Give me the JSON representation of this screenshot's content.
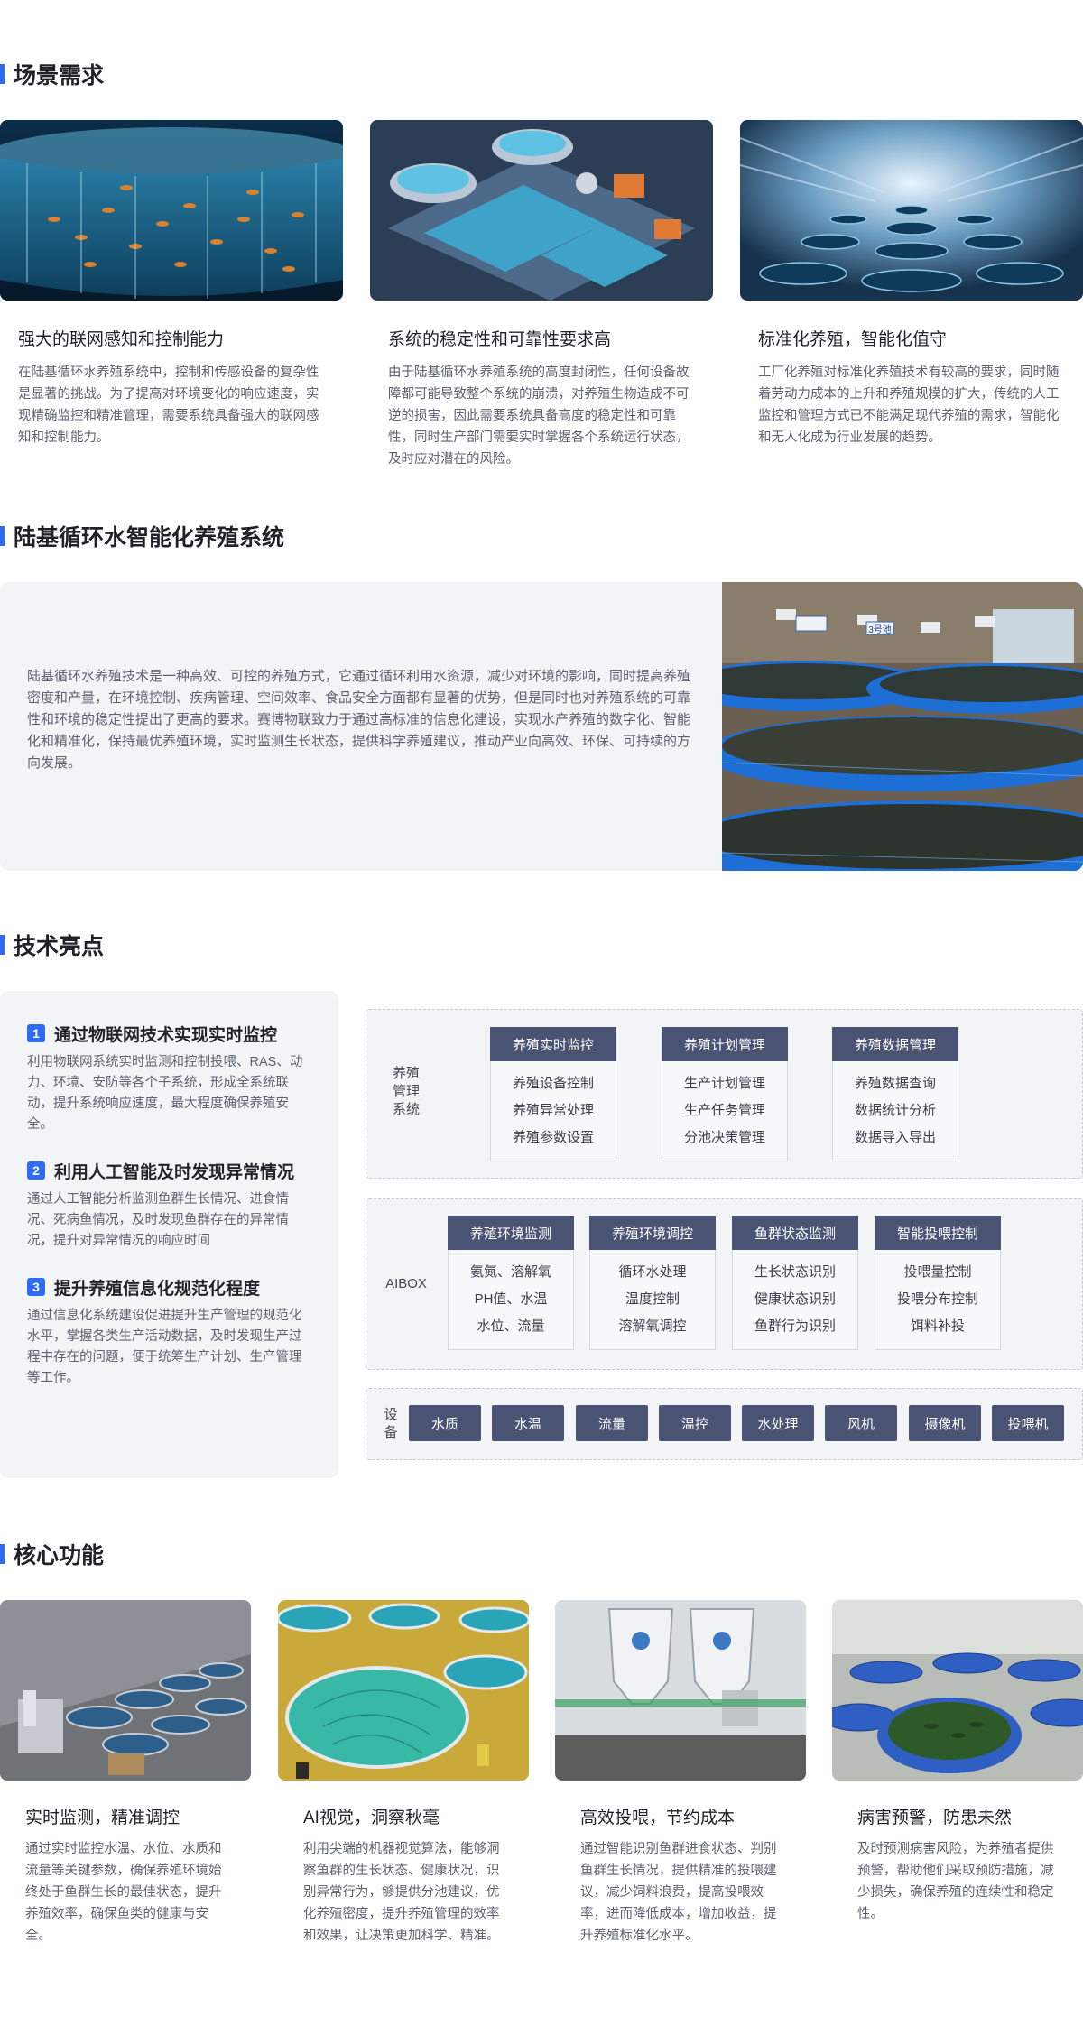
{
  "sections": {
    "scene": "场景需求",
    "system": "陆基循环水智能化养殖系统",
    "tech": "技术亮点",
    "core": "核心功能"
  },
  "scene_cards": [
    {
      "title": "强大的联网感知和控制能力",
      "text": "在陆基循环水养殖系统中，控制和传感设备的复杂性是显著的挑战。为了提高对环境变化的响应速度，实现精确监控和精准管理，需要系统具备强大的联网感知和控制能力。"
    },
    {
      "title": "系统的稳定性和可靠性要求高",
      "text": "由于陆基循环水养殖系统的高度封闭性，任何设备故障都可能导致整个系统的崩溃，对养殖生物造成不可逆的损害，因此需要系统具备高度的稳定性和可靠性，同时生产部门需要实时掌握各个系统运行状态，及时应对潜在的风险。"
    },
    {
      "title": "标准化养殖，智能化值守",
      "text": "工厂化养殖对标准化养殖技术有较高的要求，同时随着劳动力成本的上升和养殖规模的扩大，传统的人工监控和管理方式已不能满足现代养殖的需求，智能化和无人化成为行业发展的趋势。"
    }
  ],
  "intro": {
    "text": "陆基循环水养殖技术是一种高效、可控的养殖方式，它通过循环利用水资源，减少对环境的影响，同时提高养殖密度和产量，在环境控制、疾病管理、空间效率、食品安全方面都有显著的优势，但是同时也对养殖系统的可靠性和环境的稳定性提出了更高的要求。赛博物联致力于通过高标准的信息化建设，实现水产养殖的数字化、智能化和精准化，保持最优养殖环境，实时监测生长状态，提供科学养殖建议，推动产业向高效、环保、可持续的方向发展。",
    "tank_signs": [
      "3号池"
    ]
  },
  "highlights": [
    {
      "num": "1",
      "title": "通过物联网技术实现实时监控",
      "text": "利用物联网系统实时监测和控制投喂、RAS、动力、环境、安防等各个子系统，形成全系统联动，提升系统响应速度，最大程度确保养殖安全。"
    },
    {
      "num": "2",
      "title": "利用人工智能及时发现异常情况",
      "text": "通过人工智能分析监测鱼群生长情况、进食情况、死病鱼情况，及时发现鱼群存在的异常情况，提升对异常情况的响应时间"
    },
    {
      "num": "3",
      "title": "提升养殖信息化规范化程度",
      "text": "通过信息化系统建设促进提升生产管理的规范化水平，掌握各类生产活动数据，及时发现生产过程中存在的问题，便于统筹生产计划、生产管理等工作。"
    }
  ],
  "arch": {
    "mgmt_label": "养殖\n管理\n系统",
    "mgmt_modules": [
      {
        "title": "养殖实时监控",
        "items": [
          "养殖设备控制",
          "养殖异常处理",
          "养殖参数设置"
        ]
      },
      {
        "title": "养殖计划管理",
        "items": [
          "生产计划管理",
          "生产任务管理",
          "分池决策管理"
        ]
      },
      {
        "title": "养殖数据管理",
        "items": [
          "养殖数据查询",
          "数据统计分析",
          "数据导入导出"
        ]
      }
    ],
    "aibox_label": "AIBOX",
    "aibox_modules": [
      {
        "title": "养殖环境监测",
        "items": [
          "氨氮、溶解氧",
          "PH值、水温",
          "水位、流量"
        ]
      },
      {
        "title": "养殖环境调控",
        "items": [
          "循环水处理",
          "温度控制",
          "溶解氧调控"
        ]
      },
      {
        "title": "鱼群状态监测",
        "items": [
          "生长状态识别",
          "健康状态识别",
          "鱼群行为识别"
        ]
      },
      {
        "title": "智能投喂控制",
        "items": [
          "投喂量控制",
          "投喂分布控制",
          "饵料补投"
        ]
      }
    ],
    "device_label": "设\n备",
    "devices": [
      "水质",
      "水温",
      "流量",
      "温控",
      "水处理",
      "风机",
      "摄像机",
      "投喂机"
    ]
  },
  "core_cards": [
    {
      "title": "实时监测，精准调控",
      "text": "通过实时监控水温、水位、水质和流量等关键参数，确保养殖环境始终处于鱼群生长的最佳状态，提升养殖效率，确保鱼类的健康与安全。"
    },
    {
      "title": "AI视觉，洞察秋毫",
      "text": "利用尖端的机器视觉算法，能够洞察鱼群的生长状态、健康状况，识别异常行为，够提供分池建议，优化养殖密度，提升养殖管理的效率和效果，让决策更加科学、精准。"
    },
    {
      "title": "高效投喂，节约成本",
      "text": "通过智能识别鱼群进食状态、判别鱼群生长情况，提供精准的投喂建议，减少饲料浪费，提高投喂效率，进而降低成本，增加收益，提升养殖标准化水平。"
    },
    {
      "title": "病害预警，防患未然",
      "text": "及时预测病害风险，为养殖者提供预警，帮助他们采取预防措施，减少损失，确保养殖的连续性和稳定性。"
    }
  ],
  "colors": {
    "accent": "#2f6cf6",
    "module": "#4a5374",
    "panel": "#f3f4f6"
  }
}
